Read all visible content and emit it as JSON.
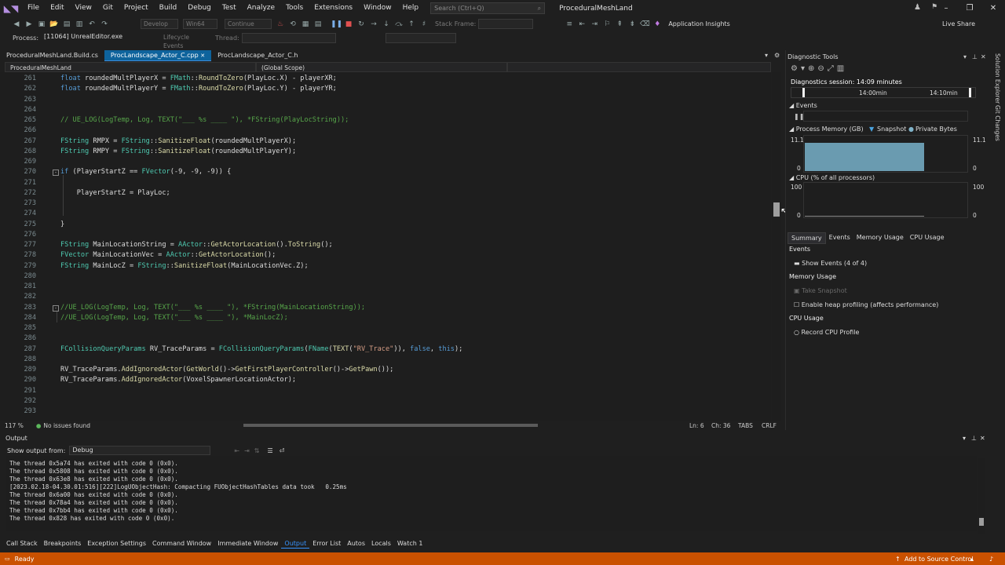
{
  "menu": [
    "File",
    "Edit",
    "View",
    "Git",
    "Project",
    "Build",
    "Debug",
    "Test",
    "Analyze",
    "Tools",
    "Extensions",
    "Window",
    "Help"
  ],
  "search_placeholder": "Search (Ctrl+Q)",
  "solution_name": "ProceduralMeshLand",
  "toolbar": {
    "config": "Develop",
    "platform": "Win64",
    "continue": "Continue",
    "stack_frame": "Stack Frame:",
    "app_insights": "Application Insights",
    "live_share": "Live Share"
  },
  "process": {
    "label": "Process:",
    "value": "[11064] UnrealEditor.exe",
    "lifecycle": "Lifecycle Events",
    "thread": "Thread:"
  },
  "tabs": [
    {
      "label": "ProceduralMeshLand.Build.cs"
    },
    {
      "label": "ProcLandscape_Actor_C.cpp"
    },
    {
      "label": "ProcLandscape_Actor_C.h"
    }
  ],
  "nav": {
    "project": "ProceduralMeshLand",
    "scope": "(Global Scope)"
  },
  "code_lines": [
    {
      "n": "261",
      "t": "float roundedMultPlayerX = FMath::RoundToZero(PlayLoc.X) - playerXR;"
    },
    {
      "n": "262",
      "t": "float roundedMultPlayerY = FMath::RoundToZero(PlayLoc.Y) - playerYR;"
    },
    {
      "n": "263",
      "t": ""
    },
    {
      "n": "264",
      "t": ""
    },
    {
      "n": "265",
      "t": "// UE_LOG(LogTemp, Log, TEXT(\"___ %s ____ \"), *FString(PlayLocString));"
    },
    {
      "n": "266",
      "t": ""
    },
    {
      "n": "267",
      "t": "FString RMPX = FString::SanitizeFloat(roundedMultPlayerX);"
    },
    {
      "n": "268",
      "t": "FString RMPY = FString::SanitizeFloat(roundedMultPlayerY);"
    },
    {
      "n": "269",
      "t": ""
    },
    {
      "n": "270",
      "t": "if (PlayerStartZ == FVector(-9, -9, -9)) {"
    },
    {
      "n": "271",
      "t": ""
    },
    {
      "n": "272",
      "t": "    PlayerStartZ = PlayLoc;"
    },
    {
      "n": "273",
      "t": ""
    },
    {
      "n": "274",
      "t": ""
    },
    {
      "n": "275",
      "t": "}"
    },
    {
      "n": "276",
      "t": ""
    },
    {
      "n": "277",
      "t": "FString MainLocationString = AActor::GetActorLocation().ToString();"
    },
    {
      "n": "278",
      "t": "FVector MainLocationVec = AActor::GetActorLocation();"
    },
    {
      "n": "279",
      "t": "FString MainLocZ = FString::SanitizeFloat(MainLocationVec.Z);"
    },
    {
      "n": "280",
      "t": ""
    },
    {
      "n": "281",
      "t": ""
    },
    {
      "n": "282",
      "t": ""
    },
    {
      "n": "283",
      "t": "//UE_LOG(LogTemp, Log, TEXT(\"___ %s ____ \"), *FString(MainLocationString));"
    },
    {
      "n": "284",
      "t": "//UE_LOG(LogTemp, Log, TEXT(\"___ %s ____ \"), *MainLocZ);"
    },
    {
      "n": "285",
      "t": ""
    },
    {
      "n": "286",
      "t": ""
    },
    {
      "n": "287",
      "t": "FCollisionQueryParams RV_TraceParams = FCollisionQueryParams(FName(TEXT(\"RV_Trace\")), false, this);"
    },
    {
      "n": "288",
      "t": ""
    },
    {
      "n": "289",
      "t": "RV_TraceParams.AddIgnoredActor(GetWorld()->GetFirstPlayerController()->GetPawn());"
    },
    {
      "n": "290",
      "t": "RV_TraceParams.AddIgnoredActor(VoxelSpawnerLocationActor);"
    },
    {
      "n": "291",
      "t": ""
    },
    {
      "n": "292",
      "t": ""
    },
    {
      "n": "293",
      "t": ""
    }
  ],
  "editor_status": {
    "zoom": "117 %",
    "issues": "No issues found",
    "ln": "Ln: 6",
    "ch": "Ch: 36",
    "tabs": "TABS",
    "eol": "CRLF"
  },
  "diagnostics": {
    "title": "Diagnostic Tools",
    "session": "Diagnostics session: 14:09 minutes",
    "t1": "14:00min",
    "t2": "14:10min",
    "events": "Events",
    "memory": "Process Memory (GB)",
    "snapshot": "Snapshot",
    "private_bytes": "Private Bytes",
    "mem_max": "11.1",
    "mem_min": "0",
    "cpu": "CPU (% of all processors)",
    "cpu_max": "100",
    "cpu_min": "0",
    "tabs": [
      "Summary",
      "Events",
      "Memory Usage",
      "CPU Usage"
    ],
    "events_head": "Events",
    "show_events": "Show Events (4 of 4)",
    "memory_head": "Memory Usage",
    "take_snapshot": "Take Snapshot",
    "heap": "Enable heap profiling (affects performance)",
    "cpu_head": "CPU Usage",
    "record_cpu": "Record CPU Profile",
    "memory_level": 0.78
  },
  "side_strip": [
    "Solution Explorer",
    "Git Changes"
  ],
  "output": {
    "title": "Output",
    "show_from": "Show output from:",
    "source": "Debug",
    "lines": [
      "The thread 0x5a74 has exited with code 0 (0x0).",
      "The thread 0x5808 has exited with code 0 (0x0).",
      "The thread 0x63e8 has exited with code 0 (0x0).",
      "[2023.02.18-04.30.01:516][222]LogUObjectHash: Compacting FUObjectHashTables data took   0.25ms",
      "The thread 0x6a00 has exited with code 0 (0x0).",
      "The thread 0x78a4 has exited with code 0 (0x0).",
      "The thread 0x7bb4 has exited with code 0 (0x0).",
      "The thread 0x828 has exited with code 0 (0x0)."
    ]
  },
  "bottom_tabs": [
    "Call Stack",
    "Breakpoints",
    "Exception Settings",
    "Command Window",
    "Immediate Window",
    "Output",
    "Error List",
    "Autos",
    "Locals",
    "Watch 1"
  ],
  "status": {
    "ready": "Ready",
    "source_control": "Add to Source Control"
  }
}
